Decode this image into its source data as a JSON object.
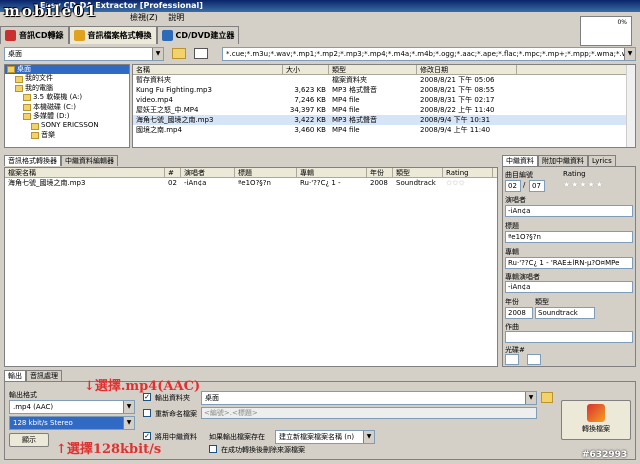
{
  "window": {
    "title": "Easy CD-DA Extractor [Professional]",
    "watermark": "mobile01",
    "id_tag": "#632993"
  },
  "menu": [
    "檢視(Z)",
    "說明"
  ],
  "main_tabs": [
    {
      "label": "音訊CD轉錄",
      "color": "#c93030"
    },
    {
      "label": "音訊檔案格式轉換",
      "color": "#e0a020"
    },
    {
      "label": "CD/DVD建立器",
      "color": "#2d6ab8"
    }
  ],
  "toolbar": {
    "location": "桌面",
    "filter": "*.cue;*.m3u;*.wav;*.mp1;*.mp2;*.mp3;*.mp4;*.m4a;*.m4b;*.ogg;*.aac;*.ape;*.flac;*.mpc;*.mp+;*.mpp;*.wma;*.wv"
  },
  "tree": [
    {
      "label": "桌面",
      "depth": 0,
      "selected": true
    },
    {
      "label": "我的文件",
      "depth": 1
    },
    {
      "label": "我的電腦",
      "depth": 1
    },
    {
      "label": "3.5 軟碟機 (A:)",
      "depth": 2
    },
    {
      "label": "本機磁碟 (C:)",
      "depth": 2
    },
    {
      "label": "多媒體 (D:)",
      "depth": 2
    },
    {
      "label": "SONY ERICSSON",
      "depth": 3
    },
    {
      "label": "音樂",
      "depth": 3
    }
  ],
  "files": {
    "headers": [
      "名稱",
      "大小",
      "類型",
      "修改日期"
    ],
    "rows": [
      [
        "暫存資料夾",
        "",
        "檔案資料夾",
        "2008/8/21 下午 05:06"
      ],
      [
        "Kung Fu Fighting.mp3",
        "3,623 KB",
        "MP3 格式聲音",
        "2008/8/21 下午 08:55"
      ],
      [
        "video.mp4",
        "7,246 KB",
        "MP4 file",
        "2008/8/31 下午 02:17"
      ],
      [
        "屋妖王之怒_中.MP4",
        "34,397 KB",
        "MP4 file",
        "2008/8/22 上午 11:40"
      ],
      [
        "海角七號_國境之南.mp3",
        "3,422 KB",
        "MP3 格式聲音",
        "2008/9/4 下午 10:31"
      ],
      [
        "國境之南.mp4",
        "3,460 KB",
        "MP4 file",
        "2008/9/4 上午 11:40"
      ]
    ],
    "selected_index": 4
  },
  "convert_tabs": [
    "音訊格式轉換器",
    "中繼資料編輯器"
  ],
  "queue": {
    "headers": [
      "檔案名稱",
      "#",
      "演唱者",
      "標題",
      "專輯",
      "年份",
      "類型",
      "Rating"
    ],
    "rows": [
      [
        "海角七號_國境之南.mp3",
        "02",
        "-iAn¢a",
        "ªe1O?§?n",
        "Ru·'??C¿ 1 -",
        "2008",
        "Soundtrack",
        "★★★"
      ]
    ]
  },
  "meta": {
    "tabs": [
      "中繼資料",
      "附加中繼資料",
      "Lyrics"
    ],
    "track_label": "曲目編號",
    "track": "02",
    "track_total": "07",
    "rating_label": "Rating",
    "rating_stars": "★★★★★",
    "artist_label": "演唱者",
    "artist": "-iAn¢a",
    "title_label": "標題",
    "title": "ªe1O?§?n",
    "album_label": "專輯",
    "album": "Ru·'??C¿ 1 - 'RAE±lRN-µ?O¤MPe",
    "album_artist_label": "專輯演唱者",
    "album_artist": "-iAn¢a",
    "year_label": "年份",
    "year": "2008",
    "genre_label": "類型",
    "genre": "Soundtrack",
    "composer_label": "作曲",
    "disc_label": "光碟#"
  },
  "bottom_tabs": [
    "輸出",
    "音訊處理"
  ],
  "output": {
    "format_label": "輸出格式",
    "format": ".mp4 (AAC)",
    "bitrate": "128 kbit/s Stereo",
    "show_button": "顯示",
    "output_folder_label": "輸出資料夾",
    "output_folder": "桌面",
    "rename_label": "重新命名檔案",
    "rename_pattern": "<編號>.<標題>",
    "use_meta_label": "將用中繼資料",
    "exists_label": "如果輸出檔案存在",
    "exists_option": "建立新檔案檔案名稱 (n)",
    "delete_label": "在成功轉換後刪除來源檔案",
    "convert_button": "轉換檔案"
  },
  "annotations": {
    "mp4": "↓選擇.mp4(AAC)",
    "bitrate": "↑選擇128kbit/s",
    "color": "#e03030"
  }
}
